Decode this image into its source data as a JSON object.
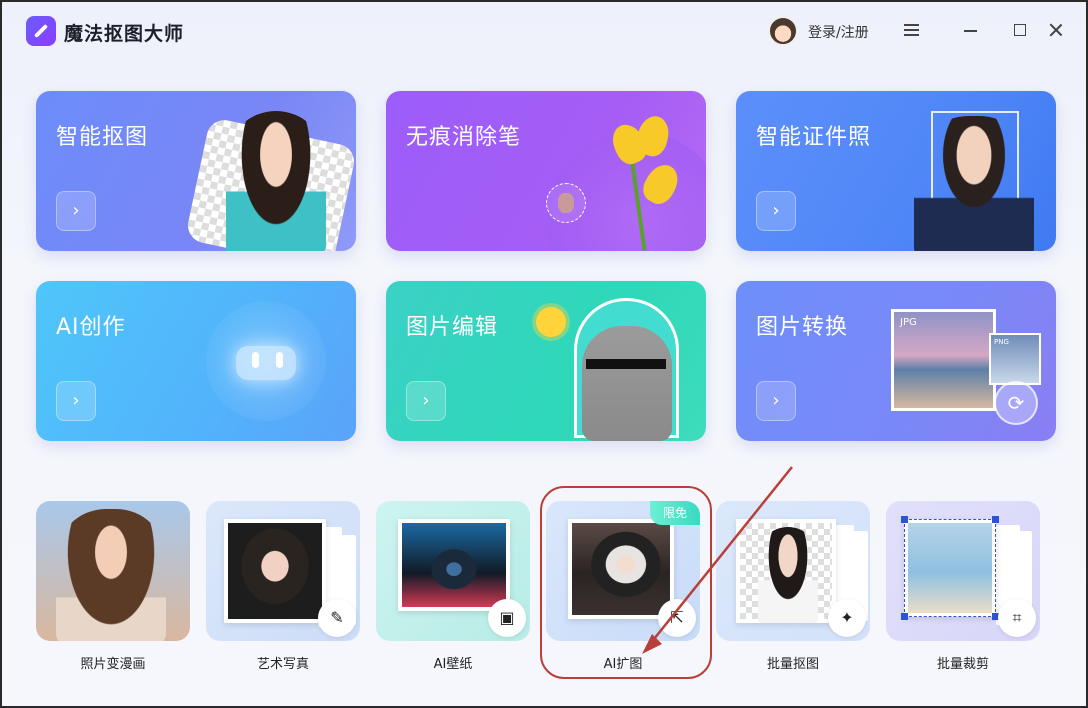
{
  "app": {
    "title": "魔法抠图大师",
    "login_label": "登录/注册"
  },
  "window_controls": [
    "menu-icon",
    "minimize-icon",
    "maximize-icon",
    "close-icon"
  ],
  "cards": [
    {
      "title": "智能抠图",
      "arrow": "›"
    },
    {
      "title": "无痕消除笔",
      "arrow": "›"
    },
    {
      "title": "智能证件照",
      "arrow": "›"
    },
    {
      "title": "AI创作",
      "arrow": "›"
    },
    {
      "title": "图片编辑",
      "arrow": "›"
    },
    {
      "title": "图片转换",
      "arrow": "›",
      "image_labels": [
        "JPG",
        "PNG"
      ]
    }
  ],
  "tools": [
    {
      "label": "照片变漫画"
    },
    {
      "label": "艺术写真",
      "icon": "brush-icon"
    },
    {
      "label": "AI壁纸",
      "icon": "image-icon"
    },
    {
      "label": "AI扩图",
      "icon": "expand-icon",
      "promo": "限免",
      "highlighted": true
    },
    {
      "label": "批量抠图",
      "icon": "magic-wand-icon"
    },
    {
      "label": "批量裁剪",
      "icon": "crop-icon"
    }
  ],
  "annotation": {
    "color": "#b9403a"
  }
}
